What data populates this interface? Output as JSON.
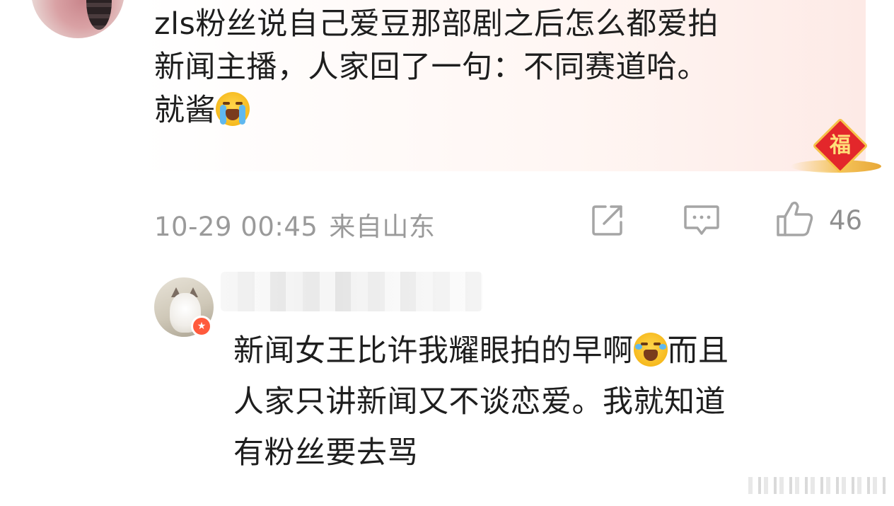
{
  "top_comment": {
    "text_line1": "zls粉丝说自己爱豆那部剧之后怎么都爱拍",
    "text_line2": "新闻主播，人家回了一句：不同赛道哈。",
    "text_line3": "就酱",
    "emoji": "crying-face-icon",
    "badge_char": "福"
  },
  "meta": {
    "timestamp": "10-29 00:45",
    "location": "来自山东",
    "like_count": "46"
  },
  "reply": {
    "text_line1_a": "新闻女王比许我耀眼拍的早啊",
    "text_line1_b": "而且",
    "text_line2": "人家只讲新闻又不谈恋爱。我就知道",
    "text_line3": "有粉丝要去骂",
    "emoji": "laughing-tears-icon"
  },
  "colors": {
    "text": "#1e1e1e",
    "meta": "#9a9a9a",
    "bubble": "#fdeae6",
    "badge_red": "#e3272b",
    "verify": "#ff5a3c"
  }
}
